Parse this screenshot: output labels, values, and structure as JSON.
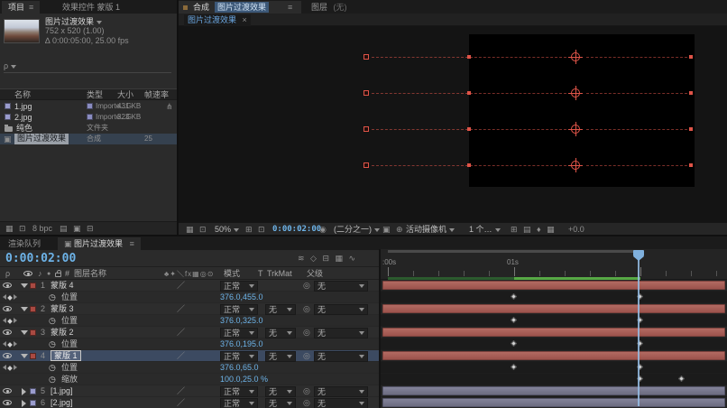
{
  "project": {
    "tabs": {
      "project": "项目",
      "effects": "效果控件 蒙版 1"
    },
    "comp_info": {
      "name": "图片过渡效果",
      "dims": "752 x 520 (1.00)",
      "meta": "0:00:05:00, 25.00 fps"
    },
    "columns": {
      "name": "名称",
      "type": "类型",
      "size": "大小",
      "framerate": "帧速率"
    },
    "items": [
      {
        "name": "1.jpg",
        "type": "Importe...G",
        "size": "431 KB",
        "framerate": ""
      },
      {
        "name": "2.jpg",
        "type": "Importe...G",
        "size": "323 KB",
        "framerate": ""
      },
      {
        "name": "纯色",
        "type": "文件夹",
        "size": "",
        "framerate": ""
      },
      {
        "name": "图片过渡效果",
        "type": "合成",
        "size": "",
        "framerate": "25"
      }
    ],
    "footer": {
      "bpc": "8 bpc"
    }
  },
  "comp": {
    "tabs": {
      "panel": "合成",
      "comp_name": "图片过渡效果",
      "layer": "图层",
      "layer_none": "(无)"
    },
    "viewer_tab": {
      "label": "图片过渡效果",
      "close": "×"
    },
    "toolbar": {
      "zoom": "50%",
      "timecode": "0:00:02:00",
      "resolution": "(二分之一)",
      "camera": "活动摄像机",
      "views": "1 个…",
      "exposure": "+0.0"
    }
  },
  "timeline": {
    "tabs": {
      "render_queue": "渲染队列",
      "comp": "图片过渡效果"
    },
    "timecode": "0:00:02:00",
    "columns": {
      "num": "#",
      "name": "图层名称",
      "mode": "模式",
      "t": "T",
      "trkmat": "TrkMat",
      "parent": "父级"
    },
    "ruler": {
      "t0": ":00s",
      "t1": "01s"
    },
    "layers": [
      {
        "num": "1",
        "name": "蒙版 4",
        "mode": "正常",
        "trkmat": "",
        "parent": "无"
      },
      {
        "num": "2",
        "name": "蒙版 3",
        "mode": "正常",
        "trkmat": "无",
        "parent": "无"
      },
      {
        "num": "3",
        "name": "蒙版 2",
        "mode": "正常",
        "trkmat": "无",
        "parent": "无"
      },
      {
        "num": "4",
        "name": "蒙版 1",
        "mode": "正常",
        "trkmat": "无",
        "parent": "无"
      },
      {
        "num": "5",
        "name": "[1.jpg]",
        "mode": "正常",
        "trkmat": "无",
        "parent": "无"
      },
      {
        "num": "6",
        "name": "[2.jpg]",
        "mode": "正常",
        "trkmat": "无",
        "parent": "无"
      }
    ],
    "props": [
      {
        "name": "位置",
        "value": "376.0,455.0"
      },
      {
        "name": "位置",
        "value": "376.0,325.0"
      },
      {
        "name": "位置",
        "value": "376.0,195.0"
      },
      {
        "name": "位置",
        "value": "376.0,65.0"
      },
      {
        "name": "缩放",
        "value": "100.0,25.0 %"
      }
    ]
  },
  "icons": {
    "menu": "≡",
    "search": "ρ",
    "stopwatch": "◷",
    "pickwhip": "◎",
    "quality": "／",
    "audio": "♪",
    "solo": "●",
    "comp": "▣",
    "branch": "⋔",
    "duration": "∆",
    "switches": "♣✦＼fx▦◎⊙",
    "viewer_a": "▦ ⊡",
    "viewer_b": "⊞ ⊡",
    "viewer_cam": "◉",
    "viewer_d": "▣ ⊕",
    "viewer_e": "⊞ ▤ ♦ ▦",
    "timeline_top": "≋ ◇ ⊟ ▦ ∿",
    "footer_a": "▦ ⊡",
    "footer_b": "▤ ▣ ⊟"
  },
  "colors": {
    "accent": "#6db3e8",
    "layer_red": "#a55c55",
    "layer_lavender": "#76768a",
    "cache_green": "#57a845"
  }
}
